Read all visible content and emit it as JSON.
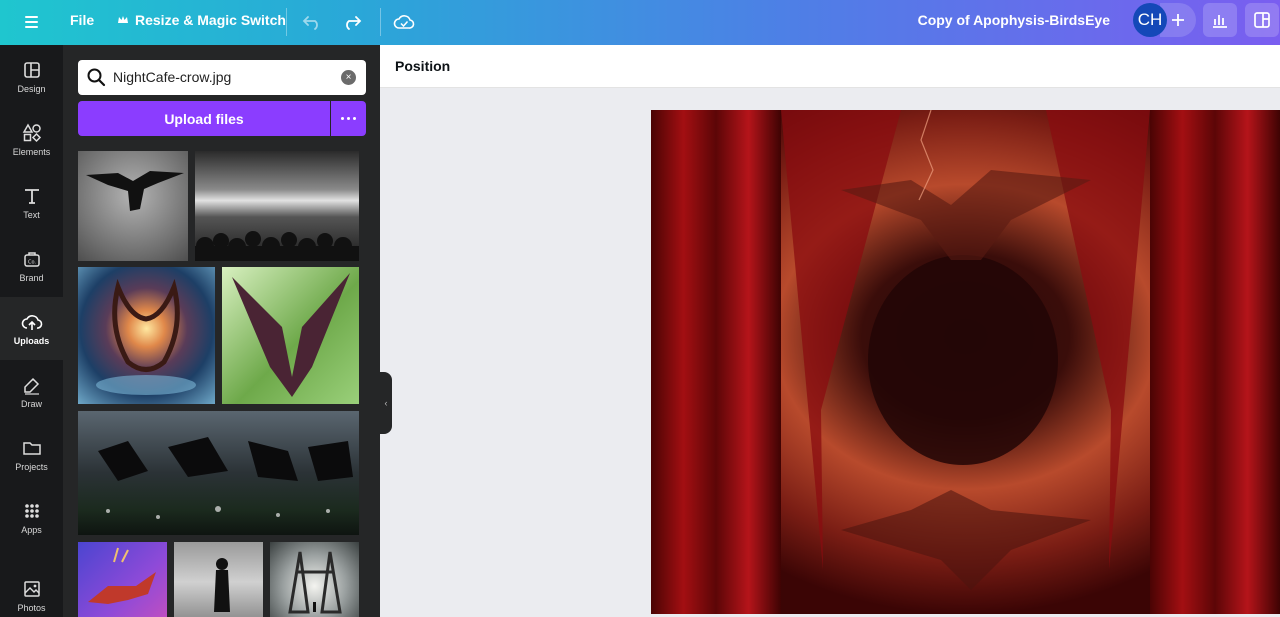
{
  "topbar": {
    "file_label": "File",
    "resize_label": "Resize & Magic Switch",
    "design_title": "Copy of Apophysis-BirdsEye",
    "avatar_initials": "CH",
    "icons": [
      "menu-icon",
      "crown-icon",
      "undo-icon",
      "redo-icon",
      "cloud-icon",
      "plus-icon",
      "analytics-icon",
      "panel-icon"
    ]
  },
  "rail": {
    "items": [
      {
        "label": "Design",
        "icon": "design-icon"
      },
      {
        "label": "Elements",
        "icon": "elements-icon"
      },
      {
        "label": "Text",
        "icon": "text-icon"
      },
      {
        "label": "Brand",
        "icon": "brand-icon"
      },
      {
        "label": "Uploads",
        "icon": "upload-icon"
      },
      {
        "label": "Draw",
        "icon": "draw-icon"
      },
      {
        "label": "Projects",
        "icon": "folder-icon"
      },
      {
        "label": "Apps",
        "icon": "apps-icon"
      },
      {
        "label": "Photos",
        "icon": "photo-icon"
      }
    ],
    "active": "Uploads"
  },
  "panel": {
    "search_value": "NightCafe-crow.jpg",
    "upload_label": "Upload files"
  },
  "toolbar": {
    "position_label": "Position"
  },
  "colors": {
    "accent": "#8b3dff",
    "rail_bg": "#18191b",
    "panel_bg": "#252627",
    "avatar": "#1448b8"
  }
}
